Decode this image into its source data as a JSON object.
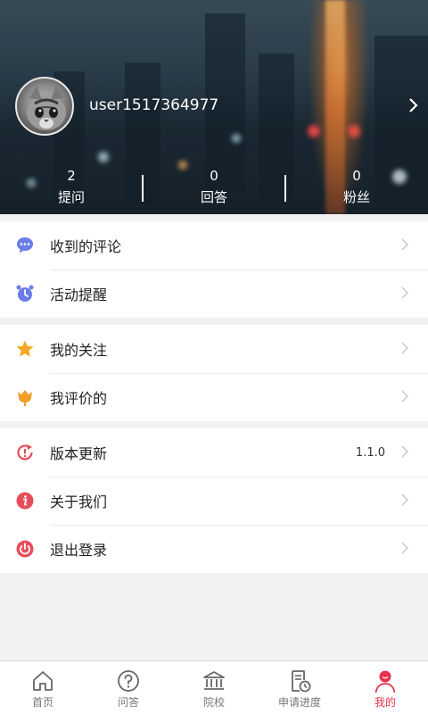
{
  "profile": {
    "username": "user1517364977",
    "stats": [
      {
        "value": "2",
        "label": "提问"
      },
      {
        "value": "0",
        "label": "回答"
      },
      {
        "value": "0",
        "label": "粉丝"
      }
    ]
  },
  "menu": {
    "group1": [
      {
        "label": "收到的评论",
        "icon": "comment-bubble-icon"
      },
      {
        "label": "活动提醒",
        "icon": "alarm-clock-icon"
      }
    ],
    "group2": [
      {
        "label": "我的关注",
        "icon": "star-icon"
      },
      {
        "label": "我评价的",
        "icon": "tulip-icon"
      }
    ],
    "group3": [
      {
        "label": "版本更新",
        "value": "1.1.0",
        "icon": "refresh-alert-icon"
      },
      {
        "label": "关于我们",
        "icon": "info-icon"
      },
      {
        "label": "退出登录",
        "icon": "power-icon"
      }
    ]
  },
  "tabs": [
    {
      "label": "首页",
      "icon": "home-icon"
    },
    {
      "label": "问答",
      "icon": "question-icon"
    },
    {
      "label": "院校",
      "icon": "school-building-icon"
    },
    {
      "label": "申请进度",
      "icon": "progress-document-icon"
    },
    {
      "label": "我的",
      "icon": "user-icon",
      "active": true
    }
  ],
  "colors": {
    "accent": "#e6324b",
    "comment_icon": "#6c7ce8",
    "star_icon": "#f5a623",
    "tulip_icon": "#f39c2a",
    "danger_icon": "#e84d5b"
  }
}
